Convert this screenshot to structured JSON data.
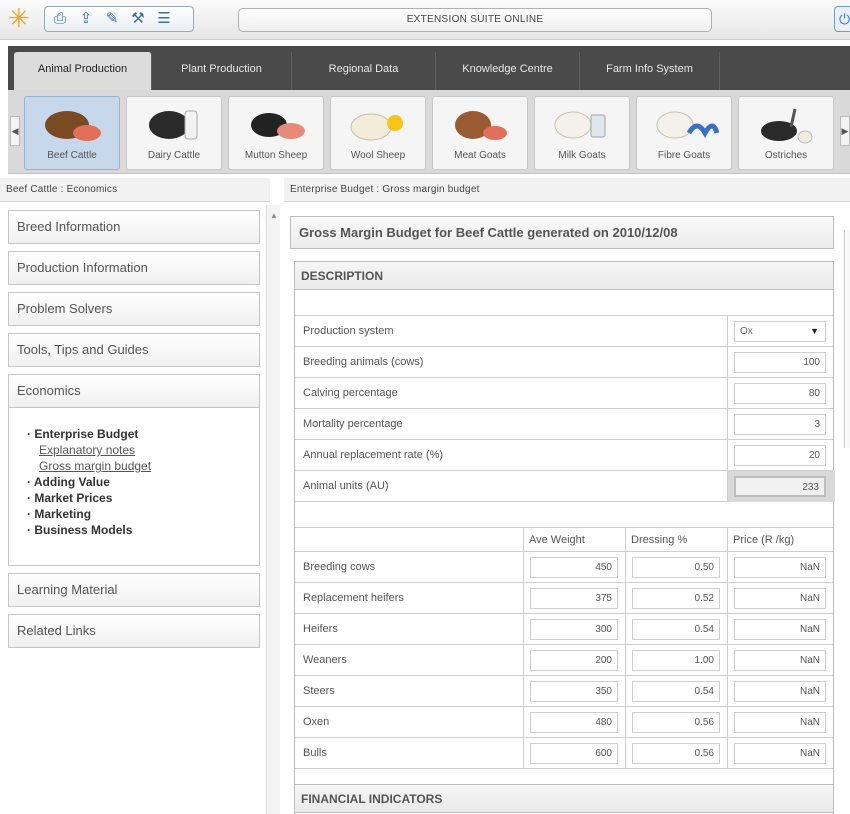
{
  "app": {
    "title": "EXTENSION SUITE ONLINE"
  },
  "toolbar": {
    "icons": [
      "print-icon",
      "upload-icon",
      "edit-icon",
      "tools-icon",
      "list-icon"
    ]
  },
  "tabs": [
    {
      "label": "Animal Production",
      "active": true
    },
    {
      "label": "Plant Production",
      "active": false
    },
    {
      "label": "Regional Data",
      "active": false
    },
    {
      "label": "Knowledge Centre",
      "active": false
    },
    {
      "label": "Farm Info System",
      "active": false
    }
  ],
  "animals": [
    {
      "label": "Beef Cattle",
      "selected": true
    },
    {
      "label": "Dairy Cattle",
      "selected": false
    },
    {
      "label": "Mutton Sheep",
      "selected": false
    },
    {
      "label": "Wool Sheep",
      "selected": false
    },
    {
      "label": "Meat Goats",
      "selected": false
    },
    {
      "label": "Milk Goats",
      "selected": false
    },
    {
      "label": "Fibre Goats",
      "selected": false
    },
    {
      "label": "Ostriches",
      "selected": false
    }
  ],
  "breadcrumbs": {
    "left": "Beef Cattle : Economics",
    "right": "Enterprise Budget : Gross margin budget"
  },
  "left_menu": {
    "items_top": [
      "Breed Information",
      "Production Information",
      "Problem Solvers",
      "Tools, Tips and Guides",
      "Economics"
    ],
    "sub": {
      "enterprise_budget": "Enterprise Budget",
      "explanatory_notes": "Explanatory notes",
      "gross_margin_budget": "Gross margin budget",
      "adding_value": "Adding Value",
      "market_prices": "Market Prices",
      "marketing": "Marketing",
      "business_models": "Business Models"
    },
    "items_bottom": [
      "Learning Material",
      "Related Links"
    ]
  },
  "content": {
    "heading": "Gross Margin Budget for Beef Cattle generated on 2010/12/08",
    "description": {
      "title": "DESCRIPTION",
      "production_system": {
        "label": "Production system",
        "value": "Ox"
      },
      "breeding_animals": {
        "label": "Breeding animals (cows)",
        "value": "100"
      },
      "calving": {
        "label": "Calving percentage",
        "value": "80"
      },
      "mortality": {
        "label": "Mortality percentage",
        "value": "3"
      },
      "replacement": {
        "label": "Annual replacement rate (%)",
        "value": "20"
      },
      "animal_units": {
        "label": "Animal units (AU)",
        "value": "233"
      }
    },
    "weights": {
      "headers": [
        "Ave Weight",
        "Dressing %",
        "Price (R /kg)"
      ],
      "rows": [
        {
          "name": "Breeding cows",
          "weight": "450",
          "dressing": "0.50",
          "price": "NaN"
        },
        {
          "name": "Replacement heifers",
          "weight": "375",
          "dressing": "0.52",
          "price": "NaN"
        },
        {
          "name": "Heifers",
          "weight": "300",
          "dressing": "0.54",
          "price": "NaN"
        },
        {
          "name": "Weaners",
          "weight": "200",
          "dressing": "1.00",
          "price": "NaN"
        },
        {
          "name": "Steers",
          "weight": "350",
          "dressing": "0.54",
          "price": "NaN"
        },
        {
          "name": "Oxen",
          "weight": "480",
          "dressing": "0.56",
          "price": "NaN"
        },
        {
          "name": "Bulls",
          "weight": "600",
          "dressing": "0.56",
          "price": "NaN"
        }
      ]
    },
    "financial": {
      "title": "FINANCIAL INDICATORS"
    }
  }
}
